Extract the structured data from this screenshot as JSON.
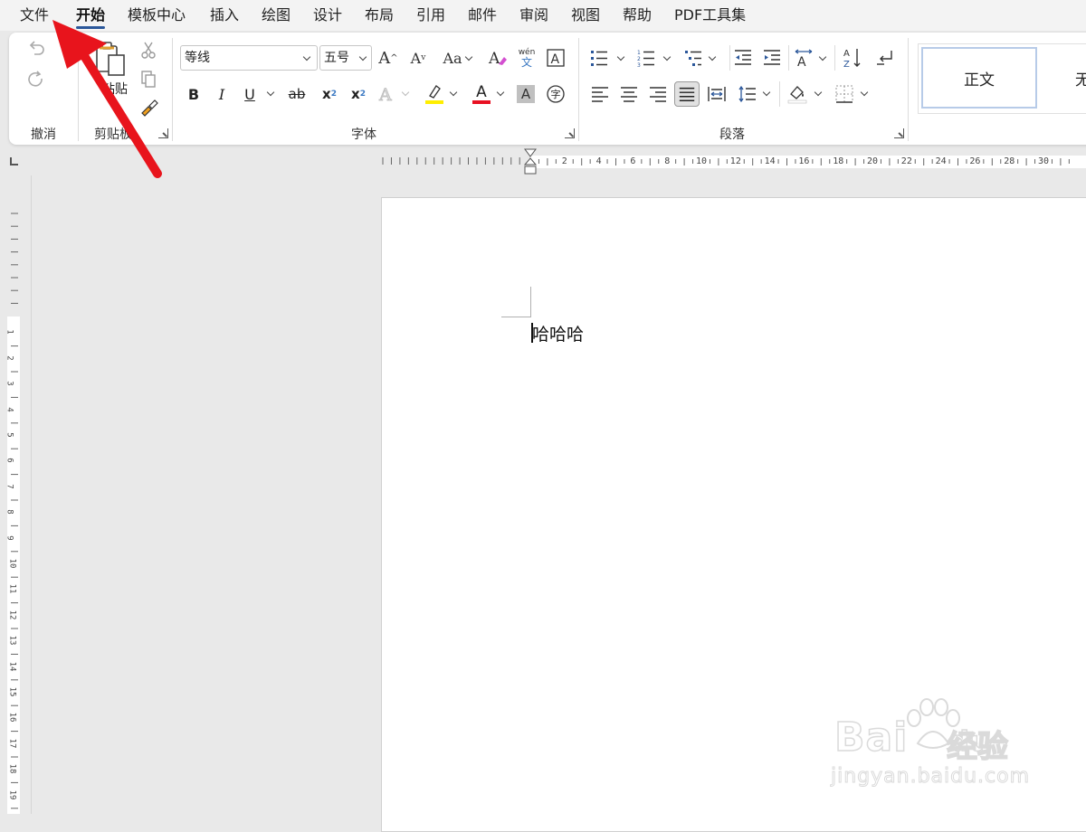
{
  "menu": {
    "items": [
      "文件",
      "开始",
      "模板中心",
      "插入",
      "绘图",
      "设计",
      "布局",
      "引用",
      "邮件",
      "审阅",
      "视图",
      "帮助",
      "PDF工具集"
    ],
    "active": "开始"
  },
  "ribbon": {
    "undo_group": {
      "label": "撤消"
    },
    "clipboard_group": {
      "label": "剪贴板",
      "paste_label": "粘贴"
    },
    "font_group": {
      "label": "字体",
      "font_name": "等线",
      "font_size": "五号",
      "phonetic_top": "wén",
      "phonetic_bottom": "文",
      "bold": "B",
      "italic": "I",
      "underline": "U",
      "strike": "ab",
      "subscript": "x",
      "superscript": "x",
      "grow_font": "A",
      "shrink_font": "A",
      "change_case": "Aa",
      "font_color": "A",
      "char_shading": "A",
      "enclose_char": "字",
      "highlight_color": "#ffee00",
      "font_color_value": "#e81123"
    },
    "paragraph_group": {
      "label": "段落"
    },
    "styles": {
      "normal": "正文",
      "next": "无"
    }
  },
  "ruler": {
    "h_numbers": [
      "2",
      "4",
      "6",
      "8",
      "10",
      "12",
      "14",
      "16",
      "18",
      "20",
      "22",
      "24",
      "26",
      "28",
      "30"
    ],
    "v_numbers": [
      "1",
      "2",
      "3",
      "4",
      "5",
      "6",
      "7",
      "8",
      "9",
      "10",
      "11",
      "12",
      "13",
      "14",
      "15",
      "16",
      "17",
      "18",
      "19"
    ]
  },
  "document": {
    "text": "哈哈哈"
  },
  "watermark": {
    "brand": "Bai",
    "brand2": "du",
    "product": "经验",
    "url": "jingyan.baidu.com"
  },
  "colors": {
    "accent": "#2b579a",
    "arrow": "#e8141c"
  }
}
